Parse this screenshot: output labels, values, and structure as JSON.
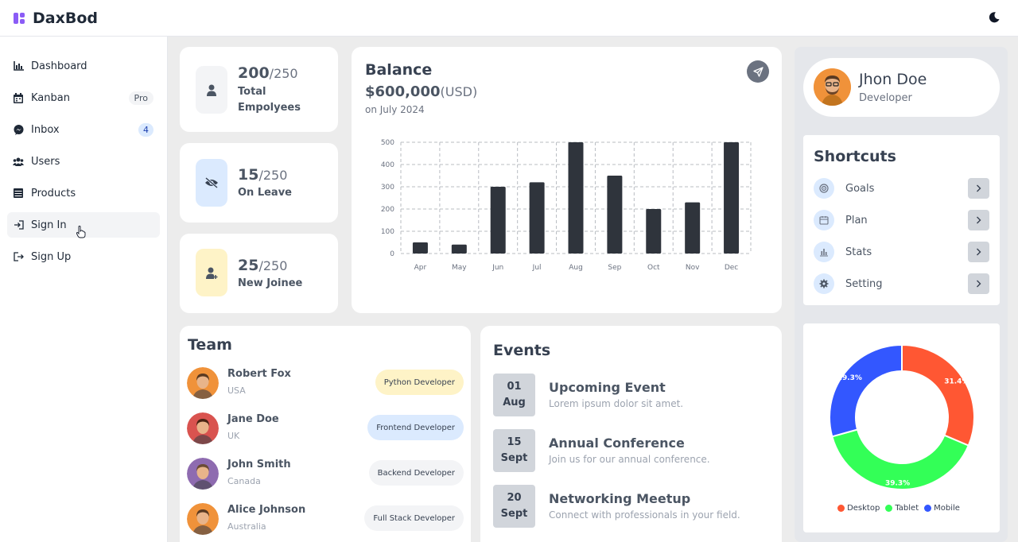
{
  "app": {
    "title": "DaxBod"
  },
  "sidebar": {
    "items": [
      {
        "label": "Dashboard",
        "icon": "chart-icon"
      },
      {
        "label": "Kanban",
        "icon": "calendar-icon",
        "badge": "Pro"
      },
      {
        "label": "Inbox",
        "icon": "messenger-icon",
        "badge": "4"
      },
      {
        "label": "Users",
        "icon": "users-icon"
      },
      {
        "label": "Products",
        "icon": "table-icon"
      },
      {
        "label": "Sign In",
        "icon": "sign-in-icon"
      },
      {
        "label": "Sign Up",
        "icon": "sign-up-icon"
      }
    ]
  },
  "stats": [
    {
      "value": "200",
      "total": "/250",
      "label_line1": "Total",
      "label_line2": "Empolyees",
      "color": "#f3f4f6",
      "icon": "user-icon"
    },
    {
      "value": "15",
      "total": "/250",
      "label_line1": "On Leave",
      "color": "#dbeafe",
      "icon": "eye-slash-icon"
    },
    {
      "value": "25",
      "total": "/250",
      "label_line1": "New Joinee",
      "color": "#fef3c7",
      "icon": "user-plus-icon"
    }
  ],
  "balance": {
    "title": "Balance",
    "amount": "$600,000",
    "currency": "(USD)",
    "date": "on July 2024"
  },
  "chart_data": [
    {
      "type": "bar",
      "categories": [
        "Apr",
        "May",
        "Jun",
        "Jul",
        "Aug",
        "Sep",
        "Oct",
        "Nov",
        "Dec"
      ],
      "values": [
        50,
        40,
        300,
        320,
        500,
        350,
        200,
        230,
        500
      ],
      "ylim": [
        0,
        500
      ],
      "yticks": [
        0,
        100,
        200,
        300,
        400,
        500
      ],
      "grid": true,
      "color": "#2f343c"
    },
    {
      "type": "pie",
      "categories": [
        "Desktop",
        "Tablet",
        "Mobile"
      ],
      "values": [
        31.4,
        39.3,
        29.3
      ],
      "labels": [
        "31.4%",
        "39.3%",
        "29.3%"
      ],
      "colors": [
        "#ff5733",
        "#33ff57",
        "#3357ff"
      ],
      "legend": "bottom"
    }
  ],
  "profile": {
    "name": "Jhon Doe",
    "role": "Developer"
  },
  "shortcuts": {
    "title": "Shortcuts",
    "items": [
      {
        "label": "Goals",
        "icon": "target-icon"
      },
      {
        "label": "Plan",
        "icon": "calendar-icon"
      },
      {
        "label": "Stats",
        "icon": "bar-chart-icon"
      },
      {
        "label": "Setting",
        "icon": "gear-icon"
      }
    ]
  },
  "team": {
    "title": "Team",
    "members": [
      {
        "name": "Robert Fox",
        "location": "USA",
        "role": "Python Developer",
        "color": "#fef3c7"
      },
      {
        "name": "Jane Doe",
        "location": "UK",
        "role": "Frontend Developer",
        "color": "#dbeafe"
      },
      {
        "name": "John Smith",
        "location": "Canada",
        "role": "Backend Developer",
        "color": "#f3f4f6"
      },
      {
        "name": "Alice Johnson",
        "location": "Australia",
        "role": "Full Stack Developer",
        "color": "#f3f4f6"
      }
    ]
  },
  "events": {
    "title": "Events",
    "items": [
      {
        "day": "01",
        "month": "Aug",
        "title": "Upcoming Event",
        "desc": "Lorem ipsum dolor sit amet."
      },
      {
        "day": "15",
        "month": "Sept",
        "title": "Annual Conference",
        "desc": "Join us for our annual conference."
      },
      {
        "day": "20",
        "month": "Sept",
        "title": "Networking Meetup",
        "desc": "Connect with professionals in your field."
      }
    ]
  }
}
